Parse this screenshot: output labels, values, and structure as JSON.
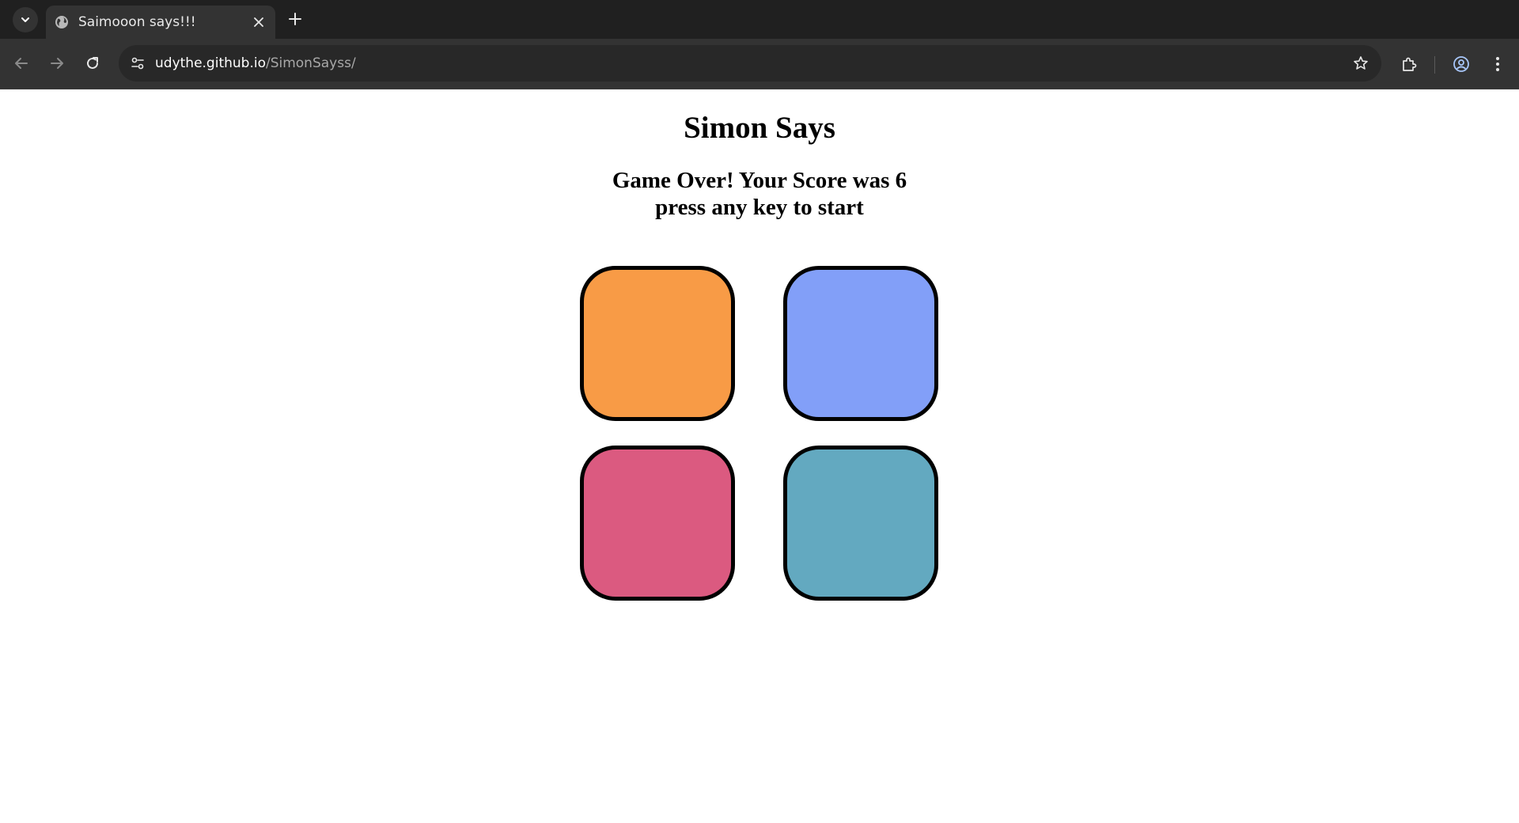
{
  "browser": {
    "tab": {
      "title": "Saimooon says!!!"
    },
    "address": {
      "host": "udythe.github.io",
      "path": "/SimonSayss/"
    }
  },
  "page": {
    "title": "Simon Says",
    "status_line1": "Game Over! Your Score was 6",
    "status_line2": "press any key to start"
  },
  "pads": {
    "top_left": {
      "color": "#f89b46"
    },
    "top_right": {
      "color": "#829ff8"
    },
    "bottom_left": {
      "color": "#db5a80"
    },
    "bottom_right": {
      "color": "#63a9c0"
    }
  },
  "icons": {
    "tab_search": "chevron-down-icon",
    "favicon": "globe-icon",
    "tab_close": "close-icon",
    "new_tab": "plus-icon",
    "back": "arrow-left-icon",
    "forward": "arrow-right-icon",
    "reload": "reload-icon",
    "site_info": "tune-icon",
    "bookmark": "star-icon",
    "extensions": "puzzle-icon",
    "profile": "profile-icon",
    "menu": "kebab-menu-icon"
  }
}
